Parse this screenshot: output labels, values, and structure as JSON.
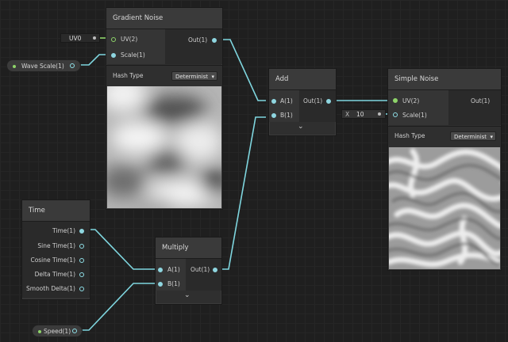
{
  "nodes": {
    "gradient_noise": {
      "title": "Gradient Noise",
      "inputs": [
        "UV(2)",
        "Scale(1)"
      ],
      "output": "Out(1)",
      "hash_label": "Hash Type",
      "hash_value": "Determinist"
    },
    "add": {
      "title": "Add",
      "inputs": [
        "A(1)",
        "B(1)"
      ],
      "output": "Out(1)"
    },
    "simple_noise": {
      "title": "Simple Noise",
      "inputs": [
        "UV(2)",
        "Scale(1)"
      ],
      "output": "Out(1)",
      "hash_label": "Hash Type",
      "hash_value": "Determinist"
    },
    "time": {
      "title": "Time",
      "outputs": [
        "Time(1)",
        "Sine Time(1)",
        "Cosine Time(1)",
        "Delta Time(1)",
        "Smooth Delta(1)"
      ]
    },
    "multiply": {
      "title": "Multiply",
      "inputs": [
        "A(1)",
        "B(1)"
      ],
      "output": "Out(1)"
    }
  },
  "properties": {
    "uv_field": "UV0",
    "wave_scale": "Wave Scale(1)",
    "speed": "Speed(1)",
    "scale_x_label": "X",
    "scale_x_value": "10"
  },
  "colors": {
    "wire": "#7fd6df",
    "port_vector": "#8ed46a",
    "port_float": "#8fd6e0"
  }
}
